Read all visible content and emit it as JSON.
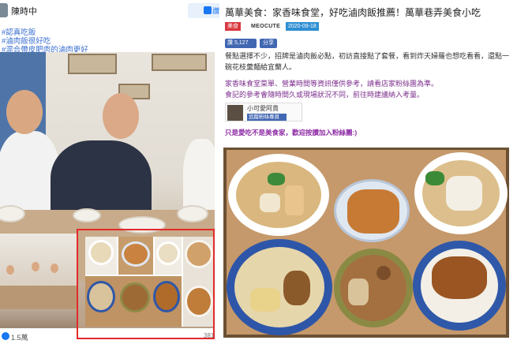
{
  "left_post": {
    "author": "陳時中",
    "like_button_label": "讚",
    "hashtags": [
      "#認真吃飯",
      "#滷肉飯很好吃",
      "#混合帶皮肥肉的滷肉更好"
    ],
    "reactions_count": "1.5萬",
    "shares_count": "381"
  },
  "article": {
    "title": "萬華美食：家香味食堂，好吃滷肉飯推薦！萬華巷弄美食小吃",
    "category_badge": "美食",
    "source": "MEOCUTE",
    "date": "2020-09-18",
    "fb_like_label": "讚 5,127",
    "fb_share_label": "分享",
    "paragraph_1": "餐點選擇不少，招牌是滷肉飯必點，初訪直接點了套餐，看到炸天婦羅也想吃看看，還點一碗花枝羹麵給宜蘭人。",
    "paragraph_2_line_1": "家香味食堂菜單、營業時間等資訊僅供參考，請看店家粉絲團為準。",
    "paragraph_2_line_2": "食記的參考會隨時間久或現場狀況不同，前往時建議納入考量。",
    "page_name": "小可愛阿貴",
    "page_follow_label": "追蹤粉絲專頁",
    "cta": "只是愛吃不是美食家，歡迎按讚加入粉絲團:)"
  },
  "colors": {
    "link_blue": "#3b6fd1",
    "highlight_red": "#e22a2a",
    "fb_blue": "#4267b2",
    "purple_text": "#7c2d8c"
  }
}
